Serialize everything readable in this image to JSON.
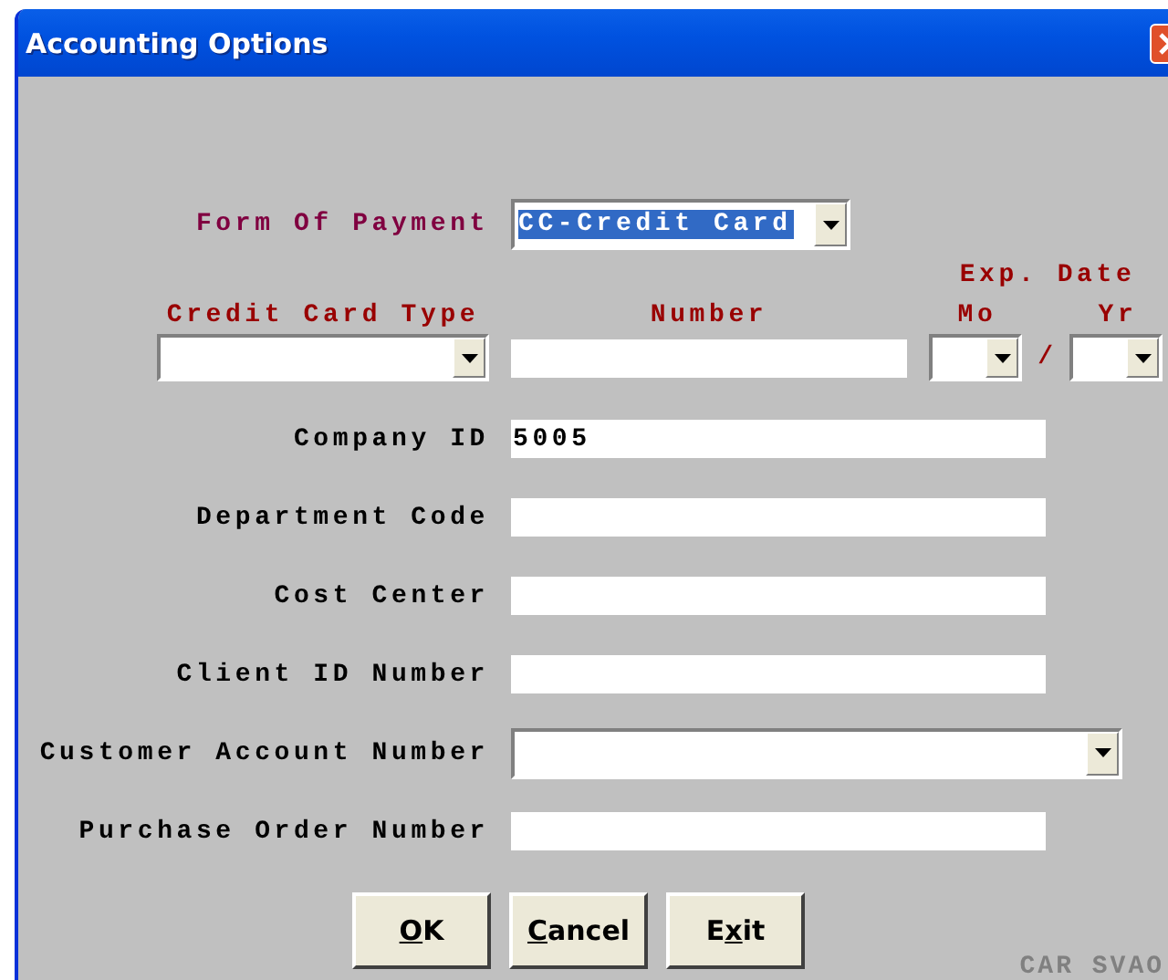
{
  "window": {
    "title": "Accounting Options"
  },
  "form_of_payment": {
    "label": "Form Of Payment",
    "value": "CC-Credit Card",
    "highlighted": true
  },
  "credit_card": {
    "exp_date_label": "Exp. Date",
    "type_label": "Credit Card Type",
    "number_label": "Number",
    "month_label": "Mo",
    "separator": "/",
    "year_label": "Yr"
  },
  "fields": [
    {
      "label": "Company ID",
      "kind": "text",
      "value": "5005"
    },
    {
      "label": "Department Code",
      "kind": "text"
    },
    {
      "label": "Cost Center",
      "kind": "text"
    },
    {
      "label": "Client ID Number",
      "kind": "text"
    },
    {
      "label": "Customer Account Number",
      "kind": "dropdown"
    },
    {
      "label": "Purchase Order Number",
      "kind": "text"
    }
  ],
  "buttons": [
    {
      "key": "O",
      "after": "K"
    },
    {
      "key": "C",
      "after": "ancel"
    },
    {
      "before": "E",
      "key": "x",
      "after": "it"
    }
  ],
  "footer_code": "CAR SVAO"
}
